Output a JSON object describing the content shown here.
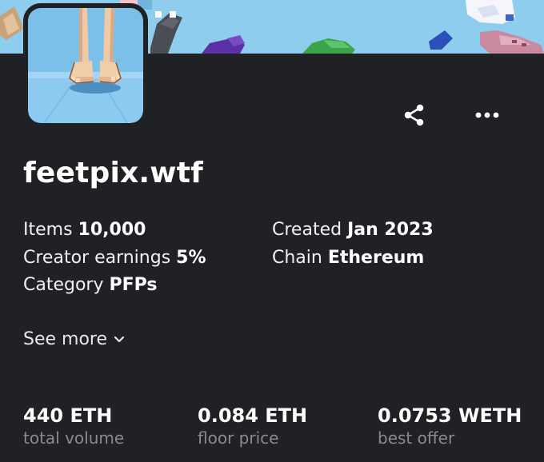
{
  "collection": {
    "name": "feetpix.wtf"
  },
  "details": {
    "items_label": "Items",
    "items_value": "10,000",
    "created_label": "Created",
    "created_value": "Jan 2023",
    "earnings_label": "Creator earnings",
    "earnings_value": "5%",
    "chain_label": "Chain",
    "chain_value": "Ethereum",
    "category_label": "Category",
    "category_value": "PFPs"
  },
  "see_more_label": "See more",
  "stats": [
    {
      "value": "440 ETH",
      "label": "total volume"
    },
    {
      "value": "0.084 ETH",
      "label": "floor price"
    },
    {
      "value": "0.0753 WETH",
      "label": "best offer"
    }
  ],
  "icons": {
    "share": "share-icon",
    "more": "more-dots-icon",
    "chevron": "chevron-down-icon"
  },
  "colors": {
    "background": "#202125",
    "banner_sky": "#8ccdee",
    "muted_text": "#8a8b8f"
  }
}
